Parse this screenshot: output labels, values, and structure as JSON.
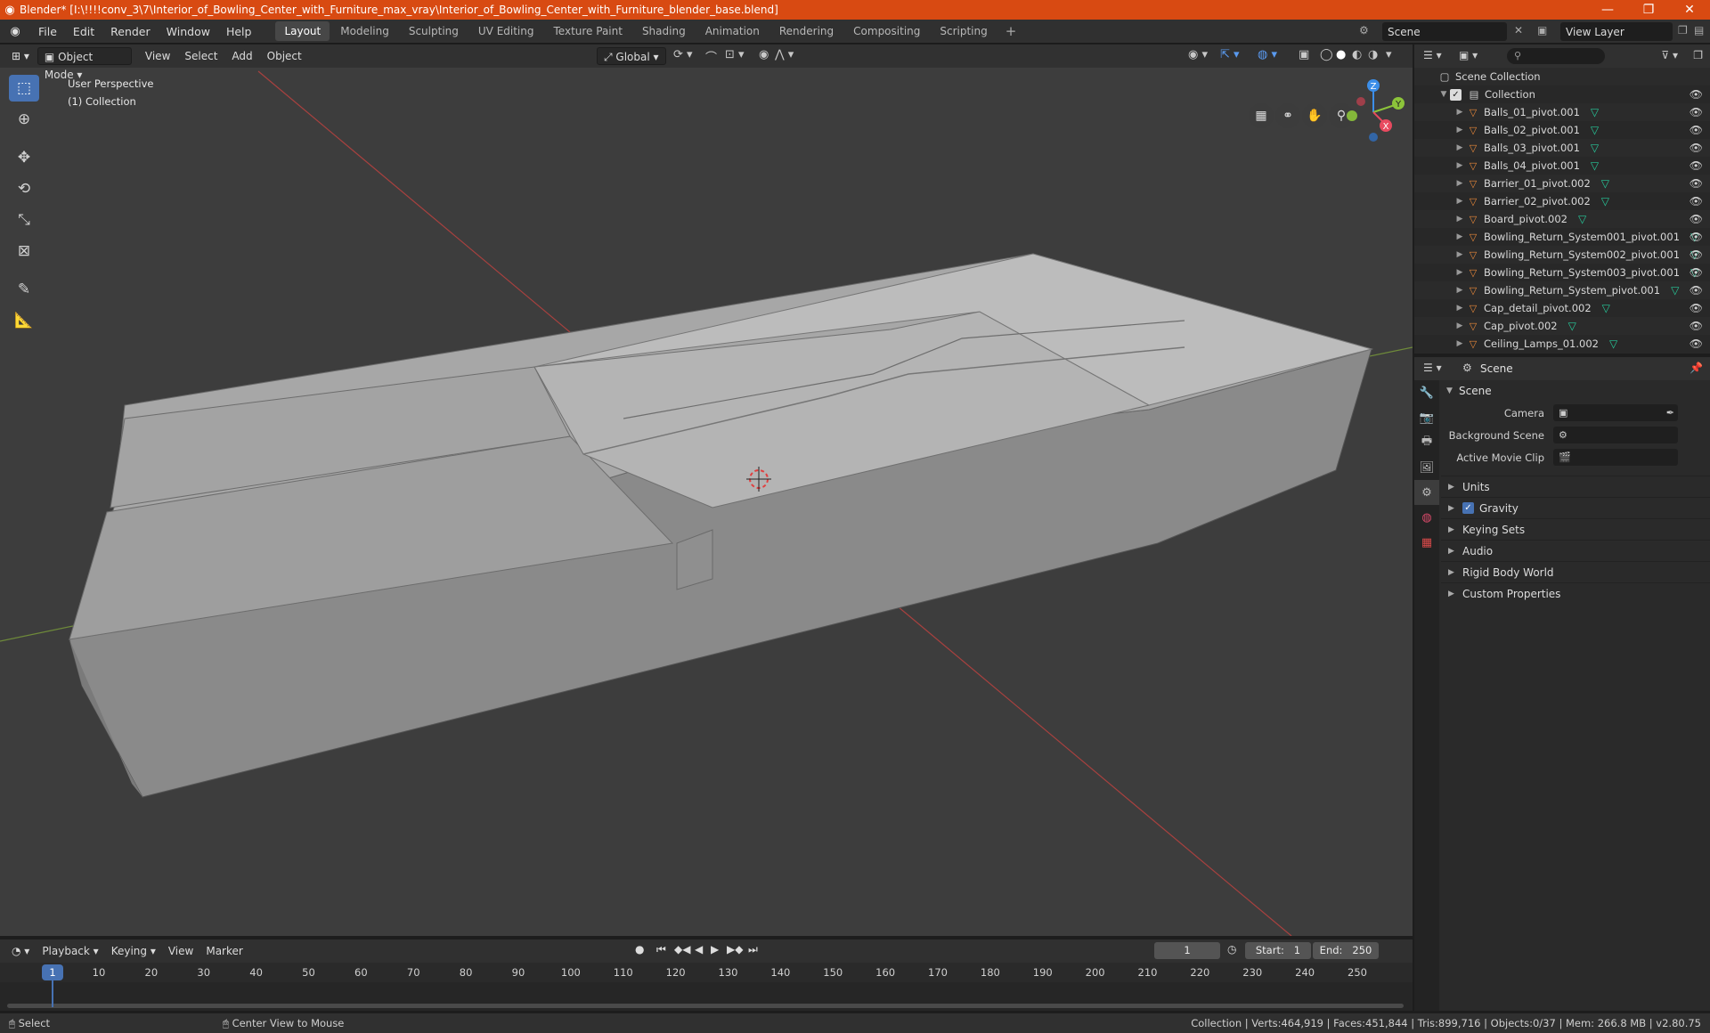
{
  "window": {
    "title": "Blender* [I:\\!!!!conv_3\\7\\Interior_of_Bowling_Center_with_Furniture_max_vray\\Interior_of_Bowling_Center_with_Furniture_blender_base.blend]",
    "minimize_icon": "minimize-icon",
    "restore_icon": "restore-icon",
    "close_icon": "close-icon"
  },
  "menus": [
    "File",
    "Edit",
    "Render",
    "Window",
    "Help"
  ],
  "workspaces": [
    "Layout",
    "Modeling",
    "Sculpting",
    "UV Editing",
    "Texture Paint",
    "Shading",
    "Animation",
    "Rendering",
    "Compositing",
    "Scripting"
  ],
  "active_workspace": "Layout",
  "scene_selector": {
    "value": "Scene"
  },
  "view_layer_selector": {
    "value": "View Layer"
  },
  "viewport": {
    "mode": "Object Mode",
    "menus": [
      "View",
      "Select",
      "Add",
      "Object"
    ],
    "transform_orientation": "Global",
    "info_line1": "User Perspective",
    "info_line2": "(1) Collection",
    "gizmo": {
      "x": "X",
      "y": "Y",
      "z": "Z",
      "x_color": "#e84a5f",
      "y_color": "#8cc43a",
      "z_color": "#3c8ee8"
    },
    "tools": [
      "select-box-icon",
      "cursor-icon",
      "move-icon",
      "rotate-icon",
      "scale-icon",
      "transform-icon",
      "annotate-icon",
      "measure-icon"
    ]
  },
  "outliner": {
    "search_placeholder": "",
    "root": "Scene Collection",
    "collection": "Collection",
    "items": [
      "Balls_01_pivot.001",
      "Balls_02_pivot.001",
      "Balls_03_pivot.001",
      "Balls_04_pivot.001",
      "Barrier_01_pivot.002",
      "Barrier_02_pivot.002",
      "Board_pivot.002",
      "Bowling_Return_System001_pivot.001",
      "Bowling_Return_System002_pivot.001",
      "Bowling_Return_System003_pivot.001",
      "Bowling_Return_System_pivot.001",
      "Cap_detail_pivot.002",
      "Cap_pivot.002",
      "Ceiling_Lamps_01.002"
    ]
  },
  "properties": {
    "header_title": "Scene",
    "panel_title": "Scene",
    "fields": [
      {
        "label": "Camera",
        "value": ""
      },
      {
        "label": "Background Scene",
        "value": ""
      },
      {
        "label": "Active Movie Clip",
        "value": ""
      }
    ],
    "subpanels": [
      "Units",
      "Gravity",
      "Keying Sets",
      "Audio",
      "Rigid Body World",
      "Custom Properties"
    ],
    "gravity_checked": true
  },
  "timeline": {
    "menus": [
      "Playback",
      "Keying",
      "View",
      "Marker"
    ],
    "current_frame": "1",
    "start_label": "Start:",
    "start": "1",
    "end_label": "End:",
    "end": "250",
    "ticks": [
      "1",
      "10",
      "20",
      "30",
      "40",
      "50",
      "60",
      "70",
      "80",
      "90",
      "100",
      "110",
      "120",
      "130",
      "140",
      "150",
      "160",
      "170",
      "180",
      "190",
      "200",
      "210",
      "220",
      "230",
      "240",
      "250"
    ]
  },
  "statusbar": {
    "left": "Select",
    "middle": "Center View to Mouse",
    "right": "Collection | Verts:464,919 | Faces:451,844 | Tris:899,716 | Objects:0/37 | Mem: 266.8 MB | v2.80.75"
  },
  "colors": {
    "accent": "#4772b3",
    "titlebar": "#d84a12",
    "viewport_bg": "#3d3d3d"
  }
}
